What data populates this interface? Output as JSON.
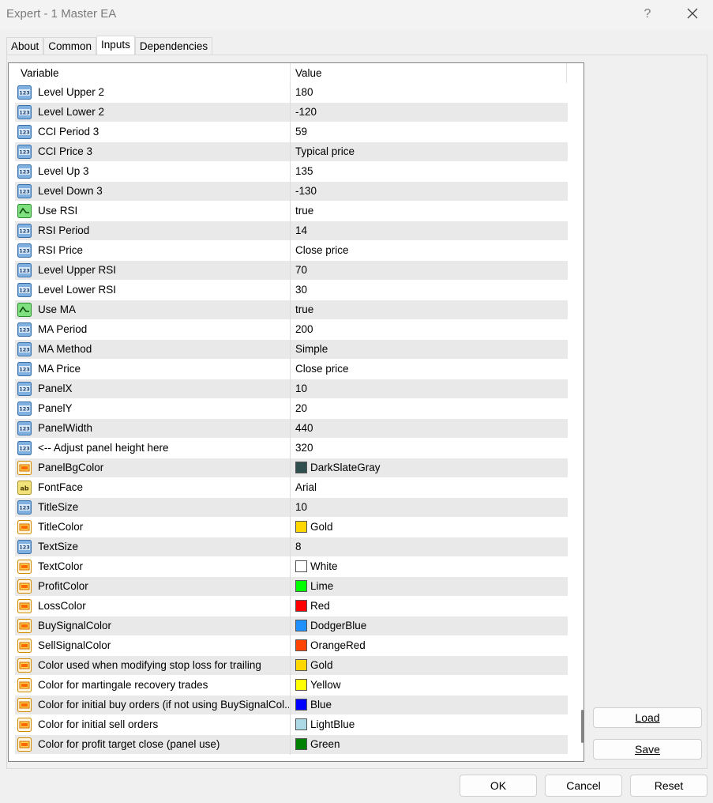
{
  "window": {
    "title": "Expert - 1 Master EA",
    "help_label": "?"
  },
  "tabs": [
    {
      "label": "About"
    },
    {
      "label": "Common"
    },
    {
      "label": "Inputs"
    },
    {
      "label": "Dependencies"
    }
  ],
  "grid": {
    "columns": {
      "variable": "Variable",
      "value": "Value"
    },
    "rows": [
      {
        "icon": "number-icon",
        "variable": "Level Upper 2",
        "value": "180"
      },
      {
        "icon": "number-icon",
        "variable": "Level Lower 2",
        "value": "-120"
      },
      {
        "icon": "number-icon",
        "variable": "CCI Period 3",
        "value": "59"
      },
      {
        "icon": "number-icon",
        "variable": "CCI Price 3",
        "value": "Typical price"
      },
      {
        "icon": "number-icon",
        "variable": "Level Up 3",
        "value": "135"
      },
      {
        "icon": "number-icon",
        "variable": "Level Down 3",
        "value": "-130"
      },
      {
        "icon": "bool-icon",
        "variable": "Use RSI",
        "value": "true"
      },
      {
        "icon": "number-icon",
        "variable": "RSI Period",
        "value": "14"
      },
      {
        "icon": "number-icon",
        "variable": "RSI Price",
        "value": "Close price"
      },
      {
        "icon": "number-icon",
        "variable": "Level Upper RSI",
        "value": "70"
      },
      {
        "icon": "number-icon",
        "variable": "Level Lower RSI",
        "value": "30"
      },
      {
        "icon": "bool-icon",
        "variable": "Use MA",
        "value": "true"
      },
      {
        "icon": "number-icon",
        "variable": "MA Period",
        "value": "200"
      },
      {
        "icon": "number-icon",
        "variable": "MA Method",
        "value": "Simple"
      },
      {
        "icon": "number-icon",
        "variable": "MA Price",
        "value": "Close price"
      },
      {
        "icon": "number-icon",
        "variable": "PanelX",
        "value": "10"
      },
      {
        "icon": "number-icon",
        "variable": "PanelY",
        "value": "20"
      },
      {
        "icon": "number-icon",
        "variable": "PanelWidth",
        "value": "440"
      },
      {
        "icon": "number-icon",
        "variable": "<-- Adjust panel height here",
        "value": "320"
      },
      {
        "icon": "color-icon",
        "variable": "PanelBgColor",
        "value": "DarkSlateGray",
        "swatch": "#2f4f4f"
      },
      {
        "icon": "string-icon",
        "variable": "FontFace",
        "value": "Arial"
      },
      {
        "icon": "number-icon",
        "variable": "TitleSize",
        "value": "10"
      },
      {
        "icon": "color-icon",
        "variable": "TitleColor",
        "value": "Gold",
        "swatch": "#ffd700"
      },
      {
        "icon": "number-icon",
        "variable": "TextSize",
        "value": "8"
      },
      {
        "icon": "color-icon",
        "variable": "TextColor",
        "value": "White",
        "swatch": "#ffffff"
      },
      {
        "icon": "color-icon",
        "variable": "ProfitColor",
        "value": "Lime",
        "swatch": "#00ff00"
      },
      {
        "icon": "color-icon",
        "variable": "LossColor",
        "value": "Red",
        "swatch": "#ff0000"
      },
      {
        "icon": "color-icon",
        "variable": "BuySignalColor",
        "value": "DodgerBlue",
        "swatch": "#1e90ff"
      },
      {
        "icon": "color-icon",
        "variable": "SellSignalColor",
        "value": "OrangeRed",
        "swatch": "#ff4500"
      },
      {
        "icon": "color-icon",
        "variable": "Color used when modifying stop loss for trailing",
        "value": "Gold",
        "swatch": "#ffd700"
      },
      {
        "icon": "color-icon",
        "variable": "Color for martingale recovery trades",
        "value": "Yellow",
        "swatch": "#ffff00"
      },
      {
        "icon": "color-icon",
        "variable": "Color for initial buy orders (if not using BuySignalCol...",
        "value": "Blue",
        "swatch": "#0000ff"
      },
      {
        "icon": "color-icon",
        "variable": "Color for initial sell orders",
        "value": "LightBlue",
        "swatch": "#add8e6"
      },
      {
        "icon": "color-icon",
        "variable": "Color for profit target close (panel use)",
        "value": "Green",
        "swatch": "#008000"
      }
    ]
  },
  "buttons": {
    "load": "Load",
    "save": "Save",
    "ok": "OK",
    "cancel": "Cancel",
    "reset": "Reset"
  }
}
